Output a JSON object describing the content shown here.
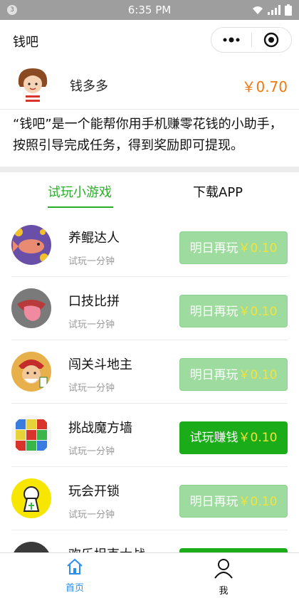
{
  "statusbar": {
    "notification_count": "3",
    "time": "6:35 PM"
  },
  "titlebar": {
    "title": "钱吧",
    "more_icon": "more-dots-icon",
    "close_icon": "target-close-icon"
  },
  "user": {
    "name": "钱多多",
    "balance": "￥0.70"
  },
  "description": "“钱吧”是一个能帮你用手机赚零花钱的小助手，按照引导完成任务，得到奖励即可提现。",
  "tabs": [
    {
      "label": "试玩小游戏",
      "active": true
    },
    {
      "label": "下载APP",
      "active": false
    }
  ],
  "games": [
    {
      "name": "养鲲达人",
      "subtitle": "试玩一分钟",
      "button_text": "明日再玩",
      "reward": "￥0.10",
      "enabled": false
    },
    {
      "name": "口技比拼",
      "subtitle": "试玩一分钟",
      "button_text": "明日再玩",
      "reward": "￥0.10",
      "enabled": false
    },
    {
      "name": "闯关斗地主",
      "subtitle": "试玩一分钟",
      "button_text": "明日再玩",
      "reward": "￥0.10",
      "enabled": false
    },
    {
      "name": "挑战魔方墙",
      "subtitle": "试玩一分钟",
      "button_text": "试玩赚钱",
      "reward": "￥0.10",
      "enabled": true
    },
    {
      "name": "玩会开锁",
      "subtitle": "试玩一分钟",
      "button_text": "明日再玩",
      "reward": "￥0.10",
      "enabled": false
    },
    {
      "name": "欢乐坦克大战",
      "subtitle": "",
      "button_text": "",
      "reward": "",
      "enabled": true
    }
  ],
  "bottomnav": [
    {
      "label": "首页",
      "icon": "home-icon",
      "active": true
    },
    {
      "label": "我",
      "icon": "person-icon",
      "active": false
    }
  ],
  "colors": {
    "accent_green": "#2aae2a",
    "button_green": "#1aad19",
    "button_disabled": "#9edb9e",
    "balance_orange": "#f07a10",
    "reward_yellow": "#f5e23b",
    "nav_active_blue": "#2b8ff0"
  }
}
